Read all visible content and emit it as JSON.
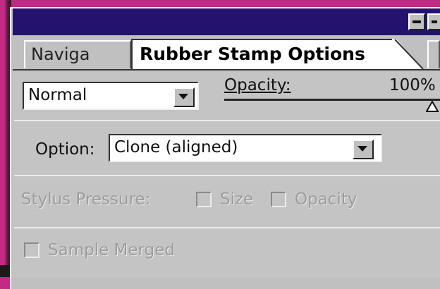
{
  "tabs": [
    {
      "label": "Naviga"
    },
    {
      "label": "Rubber Stamp Options"
    }
  ],
  "blend_mode": {
    "value": "Normal"
  },
  "opacity": {
    "label": "Opacity:",
    "value": "100%"
  },
  "option": {
    "label": "Option:",
    "value": "Clone (aligned)"
  },
  "stylus_pressure": {
    "label": "Stylus Pressure:",
    "size_label": "Size",
    "opacity_label": "Opacity",
    "size_checked": false,
    "opacity_checked": false
  },
  "sample_merged": {
    "label": "Sample Merged",
    "checked": false
  },
  "colors": {
    "titlebar": "#23126e",
    "panel": "#c4c4c4",
    "desktop": "#c22a84"
  }
}
